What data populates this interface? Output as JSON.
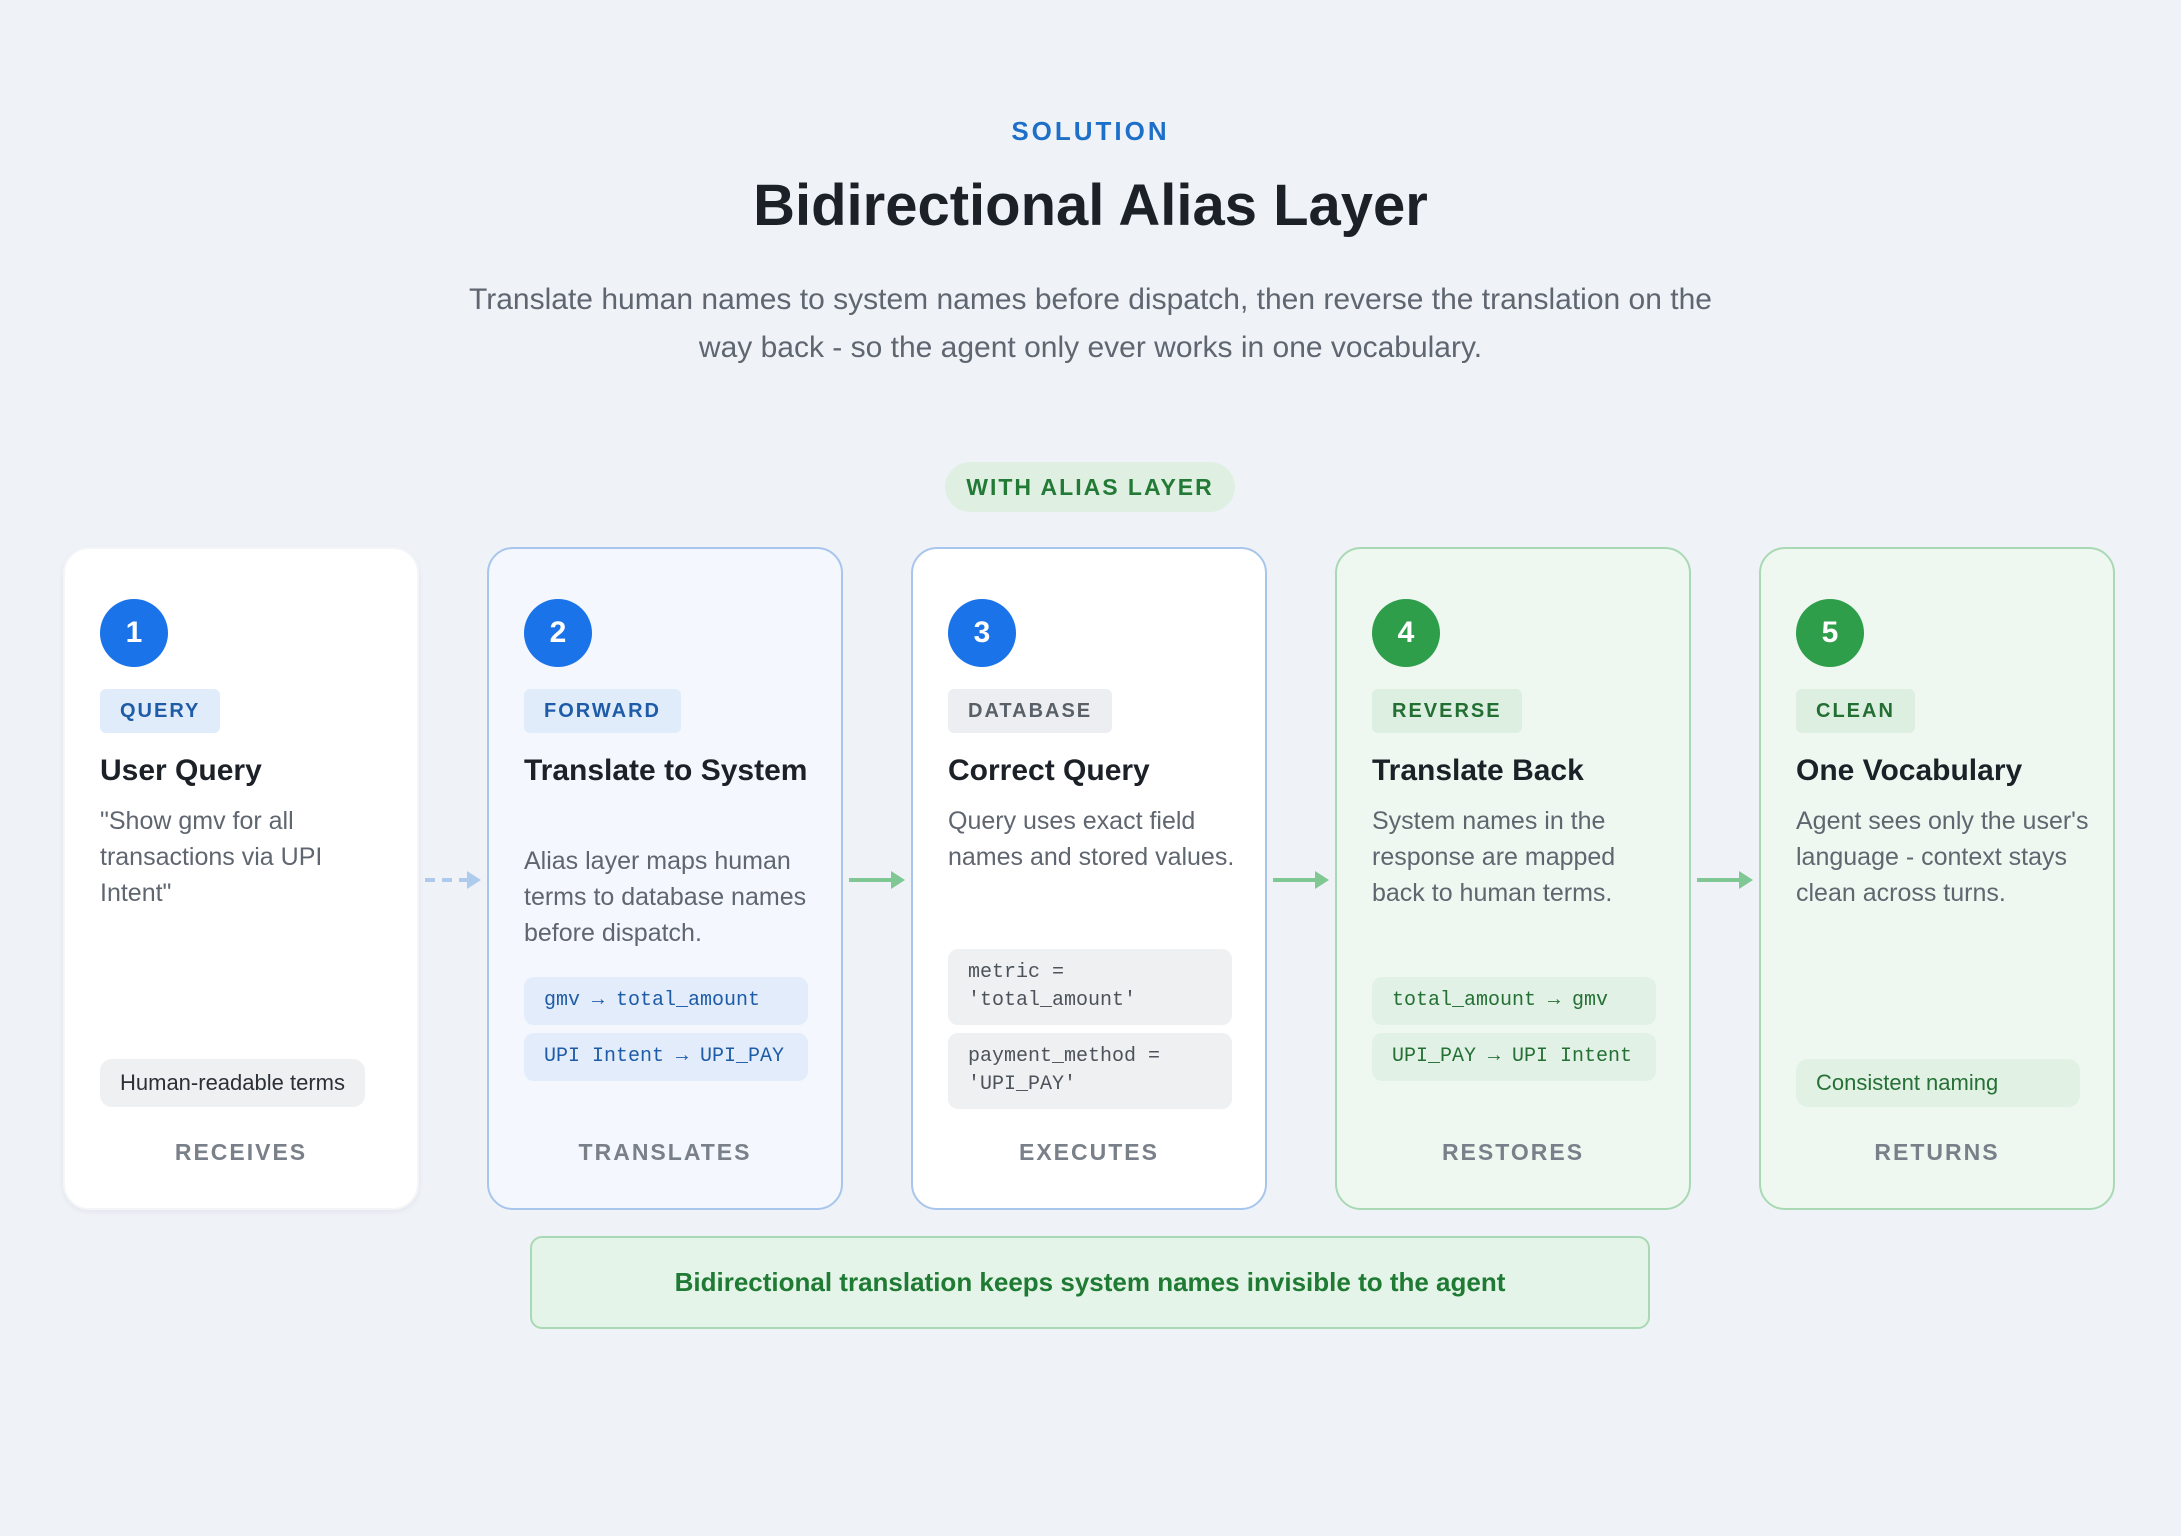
{
  "header": {
    "eyebrow": "SOLUTION",
    "title": "Bidirectional Alias Layer",
    "subtitle": "Translate human names to system names before dispatch, then reverse the translation on the way back - so the agent only ever works in one vocabulary."
  },
  "flow_badge": "WITH ALIAS LAYER",
  "steps": [
    {
      "number": "1",
      "tag": "QUERY",
      "title": "User Query",
      "description": "\"Show gmv for all transactions via UPI Intent\"",
      "pill": "Human-readable terms",
      "footer": "RECEIVES"
    },
    {
      "number": "2",
      "tag": "FORWARD",
      "title": "Translate to System",
      "description": "Alias layer maps human terms to database names before dispatch.",
      "codes": [
        "gmv → total_amount",
        "UPI Intent → UPI_PAY"
      ],
      "footer": "TRANSLATES"
    },
    {
      "number": "3",
      "tag": "DATABASE",
      "title": "Correct Query",
      "description": "Query uses exact field names and stored values.",
      "codes": [
        "metric = 'total_amount'",
        "payment_method = 'UPI_PAY'"
      ],
      "footer": "EXECUTES"
    },
    {
      "number": "4",
      "tag": "REVERSE",
      "title": "Translate Back",
      "description": "System names in the response are mapped back to human terms.",
      "codes": [
        "total_amount → gmv",
        "UPI_PAY → UPI Intent"
      ],
      "footer": "RESTORES"
    },
    {
      "number": "5",
      "tag": "CLEAN",
      "title": "One Vocabulary",
      "description": "Agent sees only the user's language - context stays clean across turns.",
      "pill": "Consistent naming",
      "footer": "RETURNS"
    }
  ],
  "colors": {
    "blue_accent": "#1a73e8",
    "green_accent": "#2e9e4b",
    "arrow_blue": "#aecbee",
    "arrow_green": "#7fc793"
  },
  "bottom_banner": "Bidirectional translation keeps system names invisible to the agent"
}
